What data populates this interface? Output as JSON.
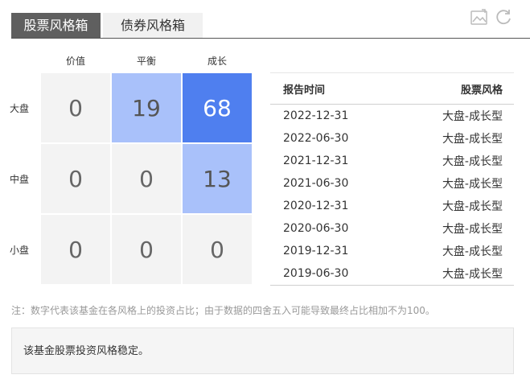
{
  "tabs": [
    {
      "label": "股票风格箱",
      "active": true
    },
    {
      "label": "债券风格箱",
      "active": false
    }
  ],
  "toolbar": {
    "image_icon": "image-icon",
    "refresh_icon": "refresh-icon"
  },
  "style_box": {
    "columns": [
      "价值",
      "平衡",
      "成长"
    ],
    "rows": [
      {
        "label": "大盘",
        "values": [
          "0",
          "19",
          "68"
        ]
      },
      {
        "label": "中盘",
        "values": [
          "0",
          "0",
          "13"
        ]
      },
      {
        "label": "小盘",
        "values": [
          "0",
          "0",
          "0"
        ]
      }
    ],
    "colors": {
      "empty": "#f3f3f3",
      "light": "#a9c1fa",
      "dark": "#4f7fef"
    }
  },
  "history": {
    "headers": [
      "报告时间",
      "股票风格"
    ],
    "rows": [
      [
        "2022-12-31",
        "大盘-成长型"
      ],
      [
        "2022-06-30",
        "大盘-成长型"
      ],
      [
        "2021-12-31",
        "大盘-成长型"
      ],
      [
        "2021-06-30",
        "大盘-成长型"
      ],
      [
        "2020-12-31",
        "大盘-成长型"
      ],
      [
        "2020-06-30",
        "大盘-成长型"
      ],
      [
        "2019-12-31",
        "大盘-成长型"
      ],
      [
        "2019-06-30",
        "大盘-成长型"
      ]
    ]
  },
  "note": "注：数字代表该基金在各风格上的投资占比；由于数据的四舍五入可能导致最终占比相加不为100。",
  "summary": "该基金股票投资风格稳定。"
}
